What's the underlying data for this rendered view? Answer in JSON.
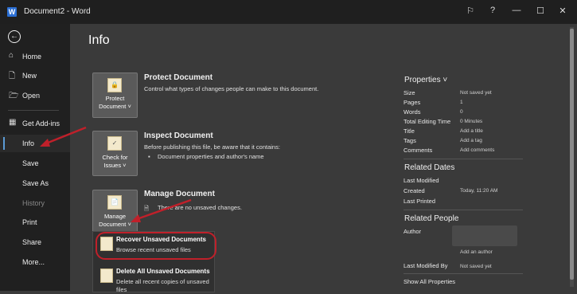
{
  "window": {
    "title": "Document2 - Word",
    "logo_letter": "W",
    "controls": {
      "pen": "⚐",
      "help": "?",
      "minimize": "—",
      "maximize": "☐",
      "close": "✕"
    }
  },
  "sidebar": {
    "back_icon": "←",
    "items": [
      {
        "label": "Home",
        "icon": "⌂"
      },
      {
        "label": "New",
        "icon": "🗋"
      },
      {
        "label": "Open",
        "icon": "🗁"
      },
      {
        "label": "Get Add-ins",
        "icon": "▦"
      },
      {
        "label": "Info"
      },
      {
        "label": "Save"
      },
      {
        "label": "Save As"
      },
      {
        "label": "History"
      },
      {
        "label": "Print"
      },
      {
        "label": "Share"
      },
      {
        "label": "More..."
      }
    ]
  },
  "main": {
    "title": "Info",
    "protect": {
      "button_line1": "Protect",
      "button_line2": "Document ˅",
      "title": "Protect Document",
      "description": "Control what types of changes people can make to this document."
    },
    "inspect": {
      "button_line1": "Check for",
      "button_line2": "Issues ˅",
      "title": "Inspect Document",
      "description": "Before publishing this file, be aware that it contains:",
      "bullet": "Document properties and author's name"
    },
    "manage": {
      "button_line1": "Manage",
      "button_line2": "Document ˅",
      "title": "Manage Document",
      "description": "There are no unsaved changes."
    },
    "dropdown": [
      {
        "title": "Recover Unsaved Documents",
        "subtitle": "Browse recent unsaved files"
      },
      {
        "title": "Delete All Unsaved Documents",
        "subtitle": "Delete all recent copies of unsaved files"
      }
    ]
  },
  "properties": {
    "heading": "Properties ˅",
    "rows": [
      {
        "label": "Size",
        "value": "Not saved yet"
      },
      {
        "label": "Pages",
        "value": "1"
      },
      {
        "label": "Words",
        "value": "0"
      },
      {
        "label": "Total Editing Time",
        "value": "0 Minutes"
      },
      {
        "label": "Title",
        "value": "Add a title"
      },
      {
        "label": "Tags",
        "value": "Add a tag"
      },
      {
        "label": "Comments",
        "value": "Add comments"
      }
    ],
    "related_dates": {
      "heading": "Related Dates",
      "rows": [
        {
          "label": "Last Modified",
          "value": ""
        },
        {
          "label": "Created",
          "value": "Today, 11:20 AM"
        },
        {
          "label": "Last Printed",
          "value": ""
        }
      ]
    },
    "related_people": {
      "heading": "Related People",
      "author_label": "Author",
      "add_author": "Add an author",
      "last_modified_by_label": "Last Modified By",
      "last_modified_by_value": "Not saved yet"
    },
    "show_all": "Show All Properties"
  },
  "colors": {
    "accent": "#5b9bd5",
    "annotation": "#c0202a"
  }
}
